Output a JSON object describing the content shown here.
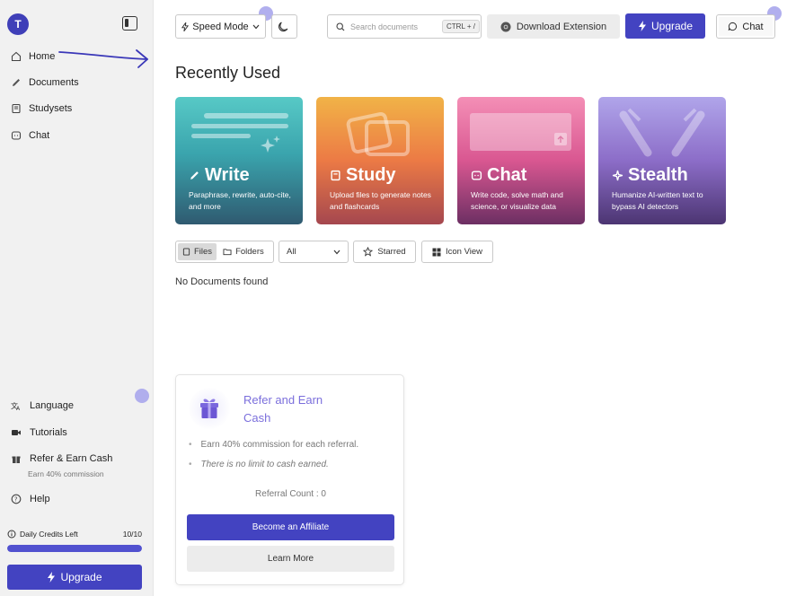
{
  "sidebar": {
    "avatar_initial": "T",
    "nav": [
      {
        "label": "Home",
        "icon": "home-icon"
      },
      {
        "label": "Documents",
        "icon": "pencil-icon"
      },
      {
        "label": "Studysets",
        "icon": "book-icon"
      },
      {
        "label": "Chat",
        "icon": "chat-icon"
      }
    ],
    "bottom": {
      "language": "Language",
      "tutorials": "Tutorials",
      "refer": "Refer & Earn Cash",
      "refer_sub": "Earn 40% commission",
      "help": "Help"
    },
    "credits": {
      "label": "Daily Credits Left",
      "value": "10/10",
      "fraction": 1.0
    },
    "upgrade_label": "Upgrade"
  },
  "topbar": {
    "speed_mode": "Speed Mode",
    "search_placeholder": "Search documents",
    "shortcut": "CTRL + /",
    "download_extension": "Download Extension",
    "upgrade": "Upgrade",
    "chat": "Chat"
  },
  "main": {
    "section_title": "Recently Used",
    "cards": [
      {
        "title": "Write",
        "desc": "Paraphrase, rewrite, auto-cite, and more"
      },
      {
        "title": "Study",
        "desc": "Upload files to generate notes and flashcards"
      },
      {
        "title": "Chat",
        "desc": "Write code, solve math and science, or visualize data"
      },
      {
        "title": "Stealth",
        "desc": "Humanize AI-written text to bypass AI detectors"
      }
    ],
    "filters": {
      "files": "Files",
      "folders": "Folders",
      "select_value": "All",
      "starred": "Starred",
      "icon_view": "Icon View"
    },
    "empty_text": "No Documents found"
  },
  "refer_card": {
    "title": "Refer and Earn Cash",
    "bullets": [
      "Earn 40% commission for each referral.",
      "There is no limit to cash earned."
    ],
    "referral_count": "Referral Count : 0",
    "affiliate_button": "Become an Affiliate",
    "learn_more": "Learn More"
  },
  "colors": {
    "brand": "#4343c1",
    "accent_text": "#7b6fdc",
    "sidebar_bg": "#f1f1f1"
  }
}
